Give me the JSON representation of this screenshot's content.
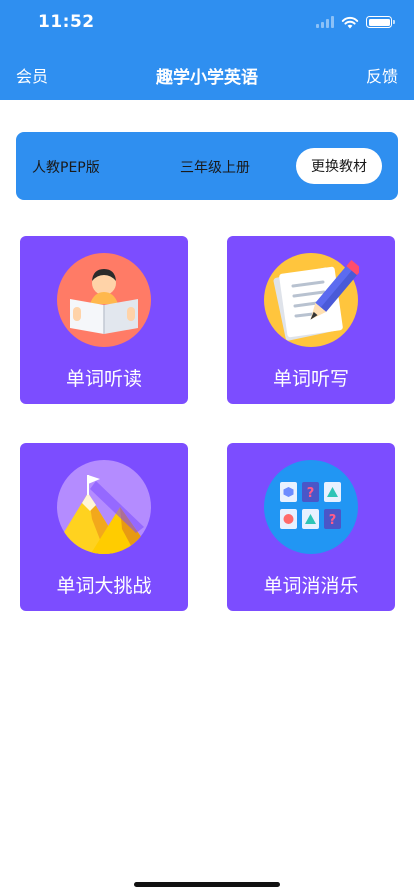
{
  "status": {
    "time": "11:52",
    "icons": [
      "signal-icon",
      "wifi-icon",
      "battery-icon"
    ]
  },
  "nav": {
    "left": "会员",
    "title": "趣学小学英语",
    "right": "反馈"
  },
  "textbook": {
    "publisher": "人教PEP版",
    "grade": "三年级上册",
    "change_label": "更换教材"
  },
  "cards": [
    {
      "label": "单词听读",
      "icon": "reading-book-icon"
    },
    {
      "label": "单词听写",
      "icon": "pencil-paper-icon"
    },
    {
      "label": "单词大挑战",
      "icon": "mountain-flag-icon"
    },
    {
      "label": "单词消消乐",
      "icon": "puzzle-grid-icon"
    }
  ],
  "colors": {
    "primary": "#2f8ff0",
    "card": "#7c4dff"
  }
}
